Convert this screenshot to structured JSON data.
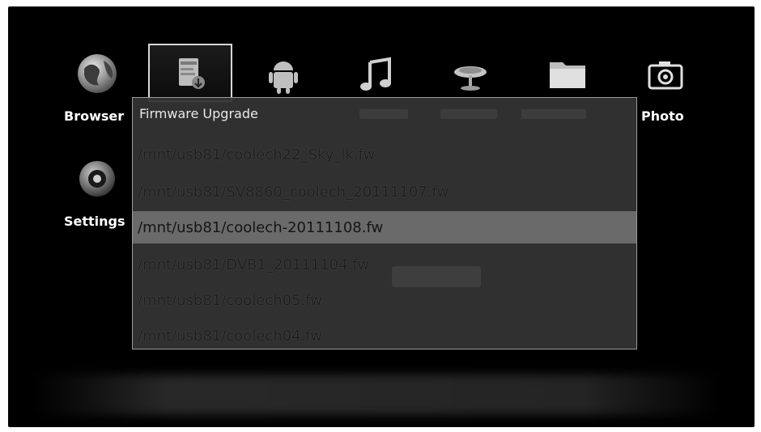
{
  "apps": [
    {
      "label": "Browser",
      "icon": "globe-icon"
    },
    {
      "label": "",
      "icon": "upgrade-icon"
    },
    {
      "label": "",
      "icon": "android-icon"
    },
    {
      "label": "",
      "icon": "music-icon"
    },
    {
      "label": "",
      "icon": "satellite-icon"
    },
    {
      "label": "",
      "icon": "folder-icon"
    },
    {
      "label": "Photo",
      "icon": "camera-icon"
    },
    {
      "label": "Settings",
      "icon": "settings-icon"
    }
  ],
  "dialog": {
    "title": "Firmware Upgrade",
    "files": [
      "/mnt/usb81/coolech22_Sky_lk.fw",
      "/mnt/usb81/SV8860_coolech_20111107.fw",
      "/mnt/usb81/coolech-20111108.fw",
      "/mnt/usb81/DVB1_20111104.fw",
      "/mnt/usb81/coolech05.fw",
      "/mnt/usb81/coolech04.fw"
    ],
    "selected_index": 2
  }
}
